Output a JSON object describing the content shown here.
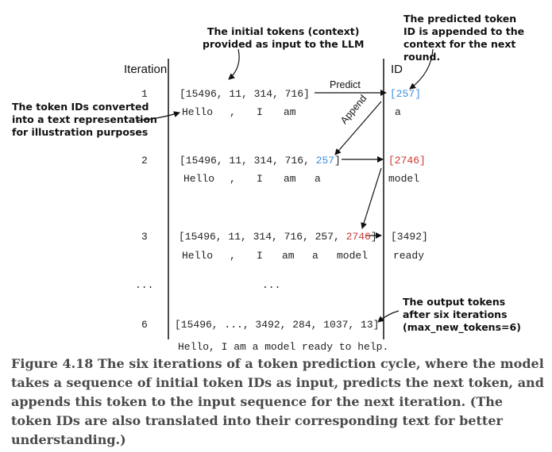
{
  "annotations": {
    "initial_tokens": [
      "The initial tokens (context)",
      "provided as input to the LLM"
    ],
    "predicted_token": [
      "The predicted token",
      "ID is appended to the",
      "context for the next round."
    ],
    "text_repr": [
      "The token IDs converted",
      "into a text representation",
      "for illustration purposes"
    ],
    "output_tokens": [
      "The output tokens",
      "after six iterations",
      "(max_new_tokens=6)"
    ]
  },
  "headers": {
    "iteration": "Iteration",
    "id": "ID"
  },
  "arrow_labels": {
    "predict": "Predict",
    "append": "Append"
  },
  "rows": [
    {
      "iteration": "1",
      "ids_prefix": "[15496, 11, 314, 716]",
      "ids_new": "",
      "ids_close": "",
      "text": [
        "Hello",
        ",",
        "I",
        "am"
      ],
      "pred_id": "[257]",
      "pred_text": "a"
    },
    {
      "iteration": "2",
      "ids_prefix": "[15496, 11, 314, 716, ",
      "ids_new": "257",
      "ids_close": "]",
      "text": [
        "Hello",
        ",",
        "I",
        "am",
        "a"
      ],
      "pred_id": "[2746]",
      "pred_text": "model"
    },
    {
      "iteration": "3",
      "ids_prefix": "[15496, 11, 314, 716, 257, ",
      "ids_new": "2746",
      "ids_close": "]",
      "text": [
        "Hello",
        ",",
        "I",
        "am",
        "a",
        "model"
      ],
      "pred_id": "[3492]",
      "pred_text": "ready"
    }
  ],
  "ellipsis": "...",
  "final_row": {
    "iteration": "6",
    "ids": "[15496, ..., 3492, 284, 1037, 13]",
    "text": "Hello, I am a model ready to help."
  },
  "caption": "Figure 4.18 The six iterations of a token prediction cycle, where the model takes a sequence of initial token IDs as input, predicts the next token, and appends this token to the input sequence for the next iteration. (The token IDs are also translated into their corresponding text for better understanding.)",
  "colors": {
    "blue": "#3d8fe0",
    "red": "#d0352f"
  }
}
